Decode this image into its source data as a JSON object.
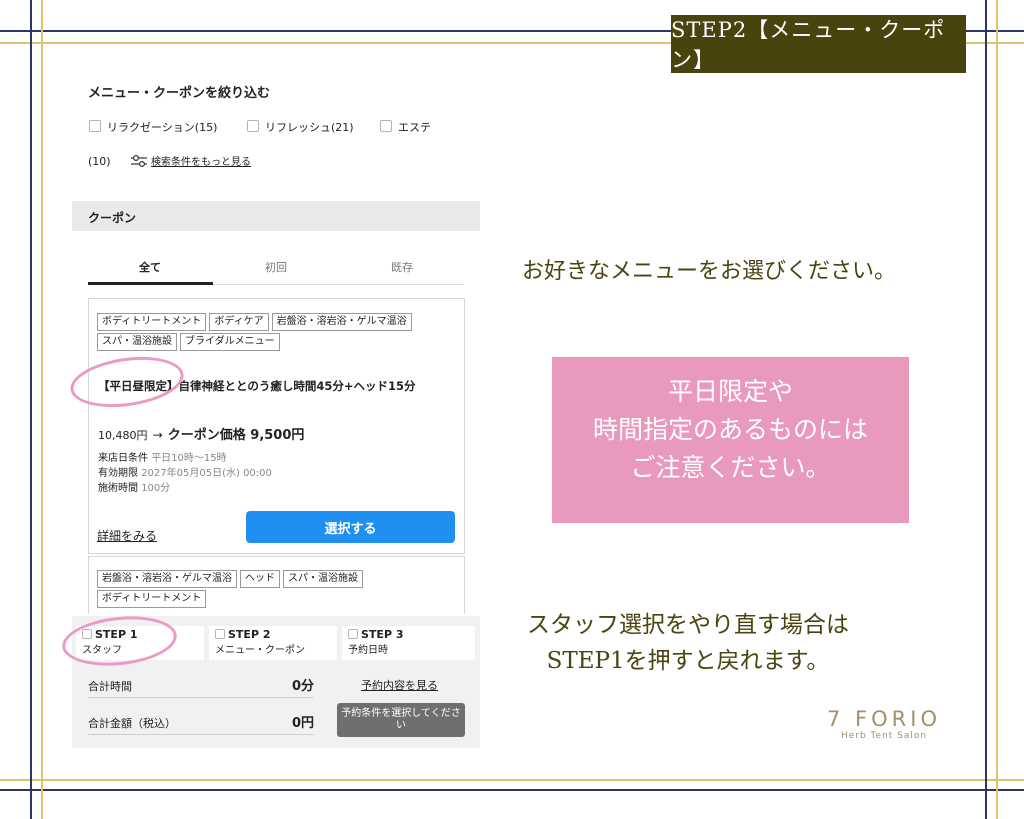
{
  "banner": {
    "title": "STEP2【メニュー・クーポン】"
  },
  "filter": {
    "heading": "メニュー・クーポンを絞り込む",
    "options": [
      {
        "label": "リラクゼーション(15)"
      },
      {
        "label": "リフレッシュ(21)"
      },
      {
        "label": "エステ"
      }
    ],
    "overflow_count": "(10)",
    "more_link": "検索条件をもっと見る"
  },
  "coupon_section": {
    "header": "クーポン",
    "tabs": [
      "全て",
      "初回",
      "既存"
    ],
    "card": {
      "tags_row1": [
        "ボディトリートメント",
        "ボディケア",
        "岩盤浴・溶岩浴・ゲルマ温浴"
      ],
      "tags_row2": [
        "スパ・温浴施設",
        "ブライダルメニュー"
      ],
      "title_prefix": "【平日昼限定】",
      "title_rest": "自律神経ととのう癒し時間45分+ヘッド15分",
      "original_price": "10,480円",
      "arrow": "→",
      "coupon_price": "クーポン価格 9,500円",
      "conditions": [
        {
          "label": "来店日条件",
          "value": "平日10時～15時"
        },
        {
          "label": "有効期限",
          "value": "2027年05月05日(水) 00:00"
        },
        {
          "label": "施術時間",
          "value": "100分"
        }
      ],
      "detail_link": "詳細をみる",
      "select_button": "選択する"
    },
    "card2": {
      "tags_row1": [
        "岩盤浴・溶岩浴・ゲルマ温浴",
        "ヘッド",
        "スパ・温浴施設"
      ],
      "tags_row2": [
        "ボディトリートメント"
      ]
    }
  },
  "steps": [
    {
      "title": "STEP 1",
      "label": "スタッフ"
    },
    {
      "title": "STEP 2",
      "label": "メニュー・クーポン"
    },
    {
      "title": "STEP 3",
      "label": "予約日時"
    }
  ],
  "summary": {
    "time_label": "合計時間",
    "time_value": "0分",
    "view_link": "予約内容を見る",
    "price_label": "合計金額（税込）",
    "price_value": "0円",
    "reserve_button": "予約条件を選択してください"
  },
  "notes": {
    "choose_menu": "お好きなメニューをお選びください。",
    "pink_line1": "平日限定や",
    "pink_line2": "時間指定のあるものには",
    "pink_line3": "ご注意ください。",
    "redo_line1": "スタッフ選択をやり直す場合は",
    "redo_line2": "STEP1を押すと戻れます。"
  },
  "brand": {
    "name": "7 FORIO",
    "tagline": "Herb Tent Salon"
  },
  "colors": {
    "navy": "#2b3566",
    "gold": "#d9c56b",
    "banner": "#49440e",
    "pink": "#e899bd",
    "blue_button": "#1f8ff0"
  }
}
